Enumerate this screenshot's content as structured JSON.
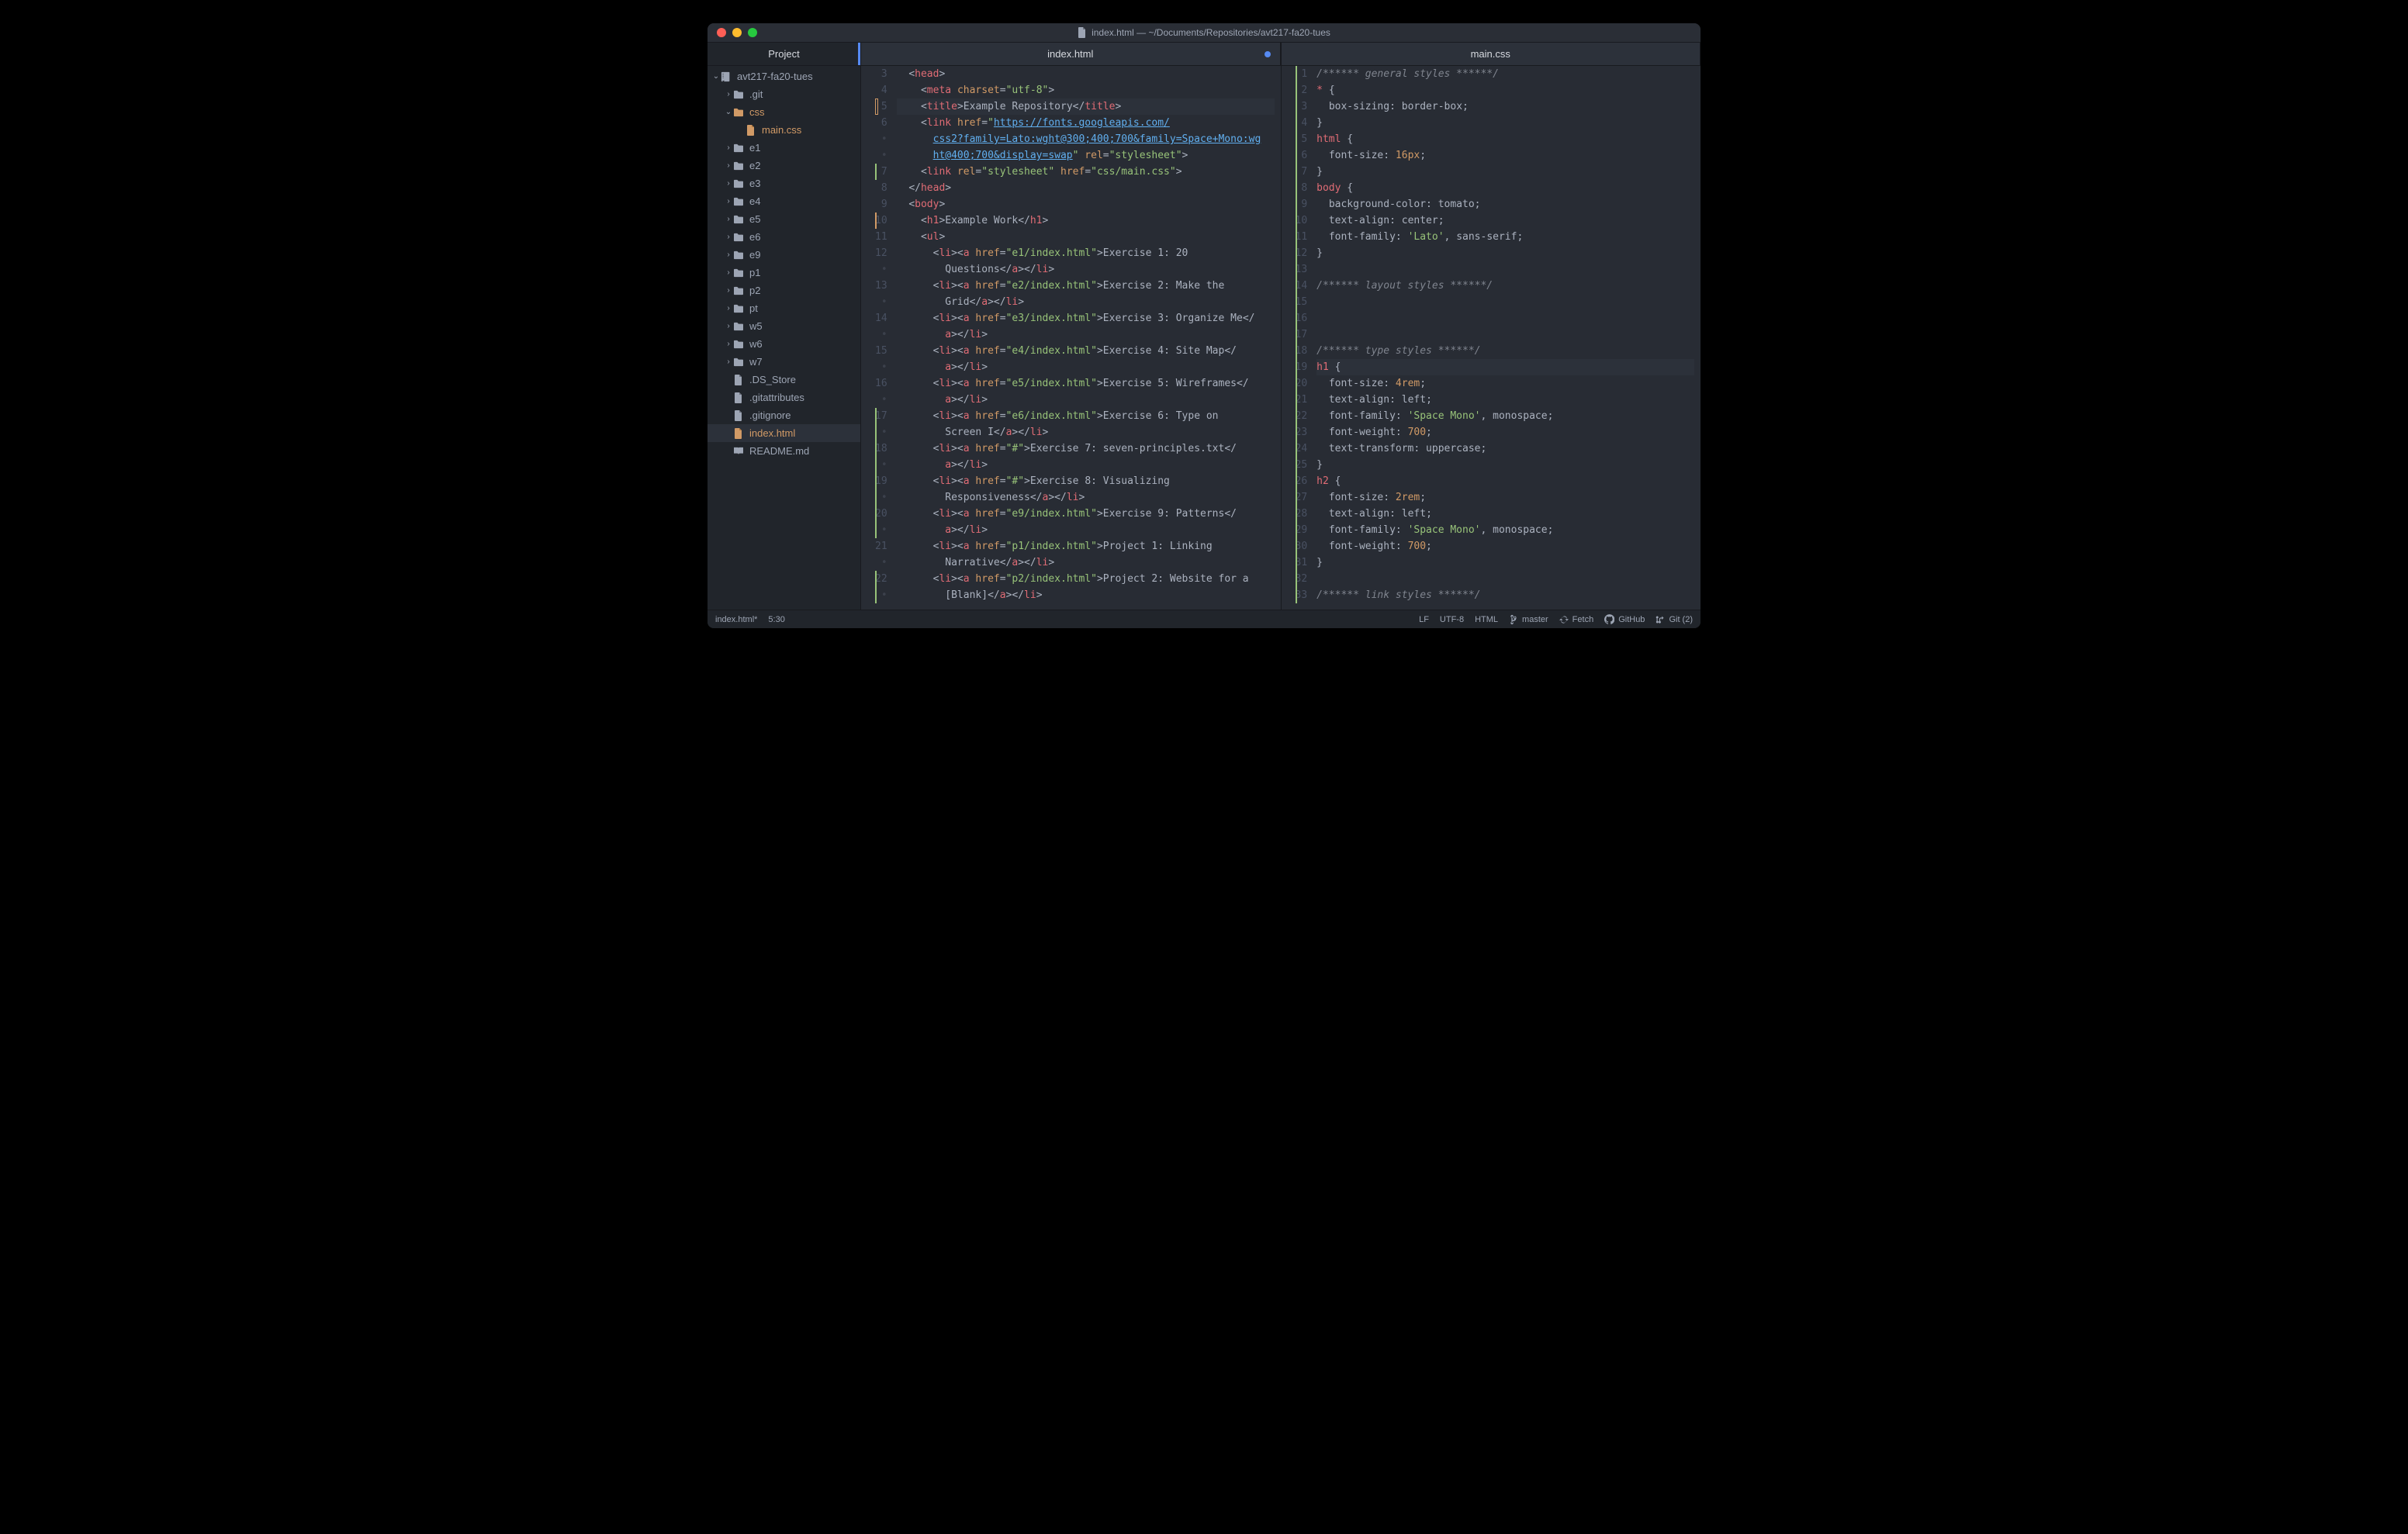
{
  "window": {
    "title": "index.html — ~/Documents/Repositories/avt217-fa20-tues"
  },
  "sidebar": {
    "header": "Project",
    "tree": [
      {
        "depth": 0,
        "kind": "repo",
        "expand": "open",
        "label": "avt217-fa20-tues",
        "mod": false
      },
      {
        "depth": 1,
        "kind": "folder",
        "expand": "closed",
        "label": ".git",
        "mod": false
      },
      {
        "depth": 1,
        "kind": "folder",
        "expand": "open",
        "label": "css",
        "mod": true
      },
      {
        "depth": 2,
        "kind": "file",
        "expand": "none",
        "label": "main.css",
        "mod": true
      },
      {
        "depth": 1,
        "kind": "folder",
        "expand": "closed",
        "label": "e1",
        "mod": false
      },
      {
        "depth": 1,
        "kind": "folder",
        "expand": "closed",
        "label": "e2",
        "mod": false
      },
      {
        "depth": 1,
        "kind": "folder",
        "expand": "closed",
        "label": "e3",
        "mod": false
      },
      {
        "depth": 1,
        "kind": "folder",
        "expand": "closed",
        "label": "e4",
        "mod": false
      },
      {
        "depth": 1,
        "kind": "folder",
        "expand": "closed",
        "label": "e5",
        "mod": false
      },
      {
        "depth": 1,
        "kind": "folder",
        "expand": "closed",
        "label": "e6",
        "mod": false
      },
      {
        "depth": 1,
        "kind": "folder",
        "expand": "closed",
        "label": "e9",
        "mod": false
      },
      {
        "depth": 1,
        "kind": "folder",
        "expand": "closed",
        "label": "p1",
        "mod": false
      },
      {
        "depth": 1,
        "kind": "folder",
        "expand": "closed",
        "label": "p2",
        "mod": false
      },
      {
        "depth": 1,
        "kind": "folder",
        "expand": "closed",
        "label": "pt",
        "mod": false
      },
      {
        "depth": 1,
        "kind": "folder",
        "expand": "closed",
        "label": "w5",
        "mod": false
      },
      {
        "depth": 1,
        "kind": "folder",
        "expand": "closed",
        "label": "w6",
        "mod": false
      },
      {
        "depth": 1,
        "kind": "folder",
        "expand": "closed",
        "label": "w7",
        "mod": false
      },
      {
        "depth": 1,
        "kind": "file",
        "expand": "none",
        "label": ".DS_Store",
        "mod": false
      },
      {
        "depth": 1,
        "kind": "file",
        "expand": "none",
        "label": ".gitattributes",
        "mod": false
      },
      {
        "depth": 1,
        "kind": "file",
        "expand": "none",
        "label": ".gitignore",
        "mod": false
      },
      {
        "depth": 1,
        "kind": "file",
        "expand": "none",
        "label": "index.html",
        "mod": true,
        "selected": true
      },
      {
        "depth": 1,
        "kind": "book",
        "expand": "none",
        "label": "README.md",
        "mod": false
      }
    ]
  },
  "panes": [
    {
      "tab": {
        "label": "index.html",
        "modified": true
      },
      "gutter_start": 3,
      "lines": [
        {
          "n": "3",
          "m": "",
          "html": "  <span class='c-pun'>&lt;</span><span class='c-tag'>head</span><span class='c-pun'>&gt;</span>"
        },
        {
          "n": "4",
          "m": "",
          "html": "    <span class='c-pun'>&lt;</span><span class='c-tag'>meta</span> <span class='c-attr'>charset</span><span class='c-pun'>=</span><span class='c-str'>\"utf-8\"</span><span class='c-pun'>&gt;</span>"
        },
        {
          "n": "5",
          "m": "box",
          "hl": true,
          "html": "    <span class='c-pun'>&lt;</span><span class='c-tag'>title</span><span class='c-pun'>&gt;</span><span class='c-txt'>Example Repository</span><span class='c-pun'>&lt;/</span><span class='c-tag'>title</span><span class='c-pun'>&gt;</span>"
        },
        {
          "n": "6",
          "m": "",
          "html": "    <span class='c-pun'>&lt;</span><span class='c-tag'>link</span> <span class='c-attr'>href</span><span class='c-pun'>=</span><span class='c-str'>\"</span><span class='c-url'>https://fonts.googleapis.com/</span>"
        },
        {
          "n": "•",
          "m": "",
          "html": "      <span class='c-url'>css2?family=Lato:wght@300;400;700&amp;family=Space+Mono:wg</span>"
        },
        {
          "n": "•",
          "m": "",
          "html": "      <span class='c-url'>ht@400;700&amp;display=swap</span><span class='c-str'>\"</span> <span class='c-attr'>rel</span><span class='c-pun'>=</span><span class='c-str'>\"stylesheet\"</span><span class='c-pun'>&gt;</span>"
        },
        {
          "n": "7",
          "m": "green",
          "html": "    <span class='c-pun'>&lt;</span><span class='c-tag'>link</span> <span class='c-attr'>rel</span><span class='c-pun'>=</span><span class='c-str'>\"stylesheet\"</span> <span class='c-attr'>href</span><span class='c-pun'>=</span><span class='c-str'>\"css/main.css\"</span><span class='c-pun'>&gt;</span>"
        },
        {
          "n": "8",
          "m": "",
          "html": "  <span class='c-pun'>&lt;/</span><span class='c-tag'>head</span><span class='c-pun'>&gt;</span>"
        },
        {
          "n": "9",
          "m": "",
          "html": "  <span class='c-pun'>&lt;</span><span class='c-tag'>body</span><span class='c-pun'>&gt;</span>"
        },
        {
          "n": "10",
          "m": "yellow",
          "html": "    <span class='c-pun'>&lt;</span><span class='c-tag'>h1</span><span class='c-pun'>&gt;</span><span class='c-txt'>Example Work</span><span class='c-pun'>&lt;/</span><span class='c-tag'>h1</span><span class='c-pun'>&gt;</span>"
        },
        {
          "n": "11",
          "m": "",
          "html": "    <span class='c-pun'>&lt;</span><span class='c-tag'>ul</span><span class='c-pun'>&gt;</span>"
        },
        {
          "n": "12",
          "m": "",
          "html": "      <span class='c-pun'>&lt;</span><span class='c-tag'>li</span><span class='c-pun'>&gt;&lt;</span><span class='c-tag'>a</span> <span class='c-attr'>href</span><span class='c-pun'>=</span><span class='c-str'>\"e1/index.html\"</span><span class='c-pun'>&gt;</span><span class='c-txt'>Exercise 1: 20 </span>"
        },
        {
          "n": "•",
          "m": "",
          "html": "        <span class='c-txt'>Questions</span><span class='c-pun'>&lt;/</span><span class='c-tag'>a</span><span class='c-pun'>&gt;&lt;/</span><span class='c-tag'>li</span><span class='c-pun'>&gt;</span>"
        },
        {
          "n": "13",
          "m": "",
          "html": "      <span class='c-pun'>&lt;</span><span class='c-tag'>li</span><span class='c-pun'>&gt;&lt;</span><span class='c-tag'>a</span> <span class='c-attr'>href</span><span class='c-pun'>=</span><span class='c-str'>\"e2/index.html\"</span><span class='c-pun'>&gt;</span><span class='c-txt'>Exercise 2: Make the </span>"
        },
        {
          "n": "•",
          "m": "",
          "html": "        <span class='c-txt'>Grid</span><span class='c-pun'>&lt;/</span><span class='c-tag'>a</span><span class='c-pun'>&gt;&lt;/</span><span class='c-tag'>li</span><span class='c-pun'>&gt;</span>"
        },
        {
          "n": "14",
          "m": "",
          "html": "      <span class='c-pun'>&lt;</span><span class='c-tag'>li</span><span class='c-pun'>&gt;&lt;</span><span class='c-tag'>a</span> <span class='c-attr'>href</span><span class='c-pun'>=</span><span class='c-str'>\"e3/index.html\"</span><span class='c-pun'>&gt;</span><span class='c-txt'>Exercise 3: Organize Me</span><span class='c-pun'>&lt;/</span>"
        },
        {
          "n": "•",
          "m": "",
          "html": "        <span class='c-tag'>a</span><span class='c-pun'>&gt;&lt;/</span><span class='c-tag'>li</span><span class='c-pun'>&gt;</span>"
        },
        {
          "n": "15",
          "m": "",
          "html": "      <span class='c-pun'>&lt;</span><span class='c-tag'>li</span><span class='c-pun'>&gt;&lt;</span><span class='c-tag'>a</span> <span class='c-attr'>href</span><span class='c-pun'>=</span><span class='c-str'>\"e4/index.html\"</span><span class='c-pun'>&gt;</span><span class='c-txt'>Exercise 4: Site Map</span><span class='c-pun'>&lt;/</span>"
        },
        {
          "n": "•",
          "m": "",
          "html": "        <span class='c-tag'>a</span><span class='c-pun'>&gt;&lt;/</span><span class='c-tag'>li</span><span class='c-pun'>&gt;</span>"
        },
        {
          "n": "16",
          "m": "",
          "html": "      <span class='c-pun'>&lt;</span><span class='c-tag'>li</span><span class='c-pun'>&gt;&lt;</span><span class='c-tag'>a</span> <span class='c-attr'>href</span><span class='c-pun'>=</span><span class='c-str'>\"e5/index.html\"</span><span class='c-pun'>&gt;</span><span class='c-txt'>Exercise 5: Wireframes</span><span class='c-pun'>&lt;/</span>"
        },
        {
          "n": "•",
          "m": "",
          "html": "        <span class='c-tag'>a</span><span class='c-pun'>&gt;&lt;/</span><span class='c-tag'>li</span><span class='c-pun'>&gt;</span>"
        },
        {
          "n": "17",
          "m": "green",
          "html": "      <span class='c-pun'>&lt;</span><span class='c-tag'>li</span><span class='c-pun'>&gt;&lt;</span><span class='c-tag'>a</span> <span class='c-attr'>href</span><span class='c-pun'>=</span><span class='c-str'>\"e6/index.html\"</span><span class='c-pun'>&gt;</span><span class='c-txt'>Exercise 6: Type on </span>"
        },
        {
          "n": "•",
          "m": "green",
          "html": "        <span class='c-txt'>Screen I</span><span class='c-pun'>&lt;/</span><span class='c-tag'>a</span><span class='c-pun'>&gt;&lt;/</span><span class='c-tag'>li</span><span class='c-pun'>&gt;</span>"
        },
        {
          "n": "18",
          "m": "green",
          "html": "      <span class='c-pun'>&lt;</span><span class='c-tag'>li</span><span class='c-pun'>&gt;&lt;</span><span class='c-tag'>a</span> <span class='c-attr'>href</span><span class='c-pun'>=</span><span class='c-str'>\"#\"</span><span class='c-pun'>&gt;</span><span class='c-txt'>Exercise 7: seven-principles.txt</span><span class='c-pun'>&lt;/</span>"
        },
        {
          "n": "•",
          "m": "green",
          "html": "        <span class='c-tag'>a</span><span class='c-pun'>&gt;&lt;/</span><span class='c-tag'>li</span><span class='c-pun'>&gt;</span>"
        },
        {
          "n": "19",
          "m": "green",
          "html": "      <span class='c-pun'>&lt;</span><span class='c-tag'>li</span><span class='c-pun'>&gt;&lt;</span><span class='c-tag'>a</span> <span class='c-attr'>href</span><span class='c-pun'>=</span><span class='c-str'>\"#\"</span><span class='c-pun'>&gt;</span><span class='c-txt'>Exercise 8: Visualizing </span>"
        },
        {
          "n": "•",
          "m": "green",
          "html": "        <span class='c-txt'>Responsiveness</span><span class='c-pun'>&lt;/</span><span class='c-tag'>a</span><span class='c-pun'>&gt;&lt;/</span><span class='c-tag'>li</span><span class='c-pun'>&gt;</span>"
        },
        {
          "n": "20",
          "m": "green",
          "html": "      <span class='c-pun'>&lt;</span><span class='c-tag'>li</span><span class='c-pun'>&gt;&lt;</span><span class='c-tag'>a</span> <span class='c-attr'>href</span><span class='c-pun'>=</span><span class='c-str'>\"e9/index.html\"</span><span class='c-pun'>&gt;</span><span class='c-txt'>Exercise 9: Patterns</span><span class='c-pun'>&lt;/</span>"
        },
        {
          "n": "•",
          "m": "green",
          "html": "        <span class='c-tag'>a</span><span class='c-pun'>&gt;&lt;/</span><span class='c-tag'>li</span><span class='c-pun'>&gt;</span>"
        },
        {
          "n": "21",
          "m": "",
          "html": "      <span class='c-pun'>&lt;</span><span class='c-tag'>li</span><span class='c-pun'>&gt;&lt;</span><span class='c-tag'>a</span> <span class='c-attr'>href</span><span class='c-pun'>=</span><span class='c-str'>\"p1/index.html\"</span><span class='c-pun'>&gt;</span><span class='c-txt'>Project 1: Linking </span>"
        },
        {
          "n": "•",
          "m": "",
          "html": "        <span class='c-txt'>Narrative</span><span class='c-pun'>&lt;/</span><span class='c-tag'>a</span><span class='c-pun'>&gt;&lt;/</span><span class='c-tag'>li</span><span class='c-pun'>&gt;</span>"
        },
        {
          "n": "22",
          "m": "green",
          "html": "      <span class='c-pun'>&lt;</span><span class='c-tag'>li</span><span class='c-pun'>&gt;&lt;</span><span class='c-tag'>a</span> <span class='c-attr'>href</span><span class='c-pun'>=</span><span class='c-str'>\"p2/index.html\"</span><span class='c-pun'>&gt;</span><span class='c-txt'>Project 2: Website for a </span>"
        },
        {
          "n": "•",
          "m": "green",
          "html": "        <span class='c-txt'>[Blank]</span><span class='c-pun'>&lt;/</span><span class='c-tag'>a</span><span class='c-pun'>&gt;&lt;/</span><span class='c-tag'>li</span><span class='c-pun'>&gt;</span>"
        }
      ]
    },
    {
      "tab": {
        "label": "main.css",
        "modified": false
      },
      "lines": [
        {
          "n": "1",
          "m": "green",
          "html": "<span class='c-com'>/****** general styles ******/</span>"
        },
        {
          "n": "2",
          "m": "green",
          "html": "<span class='c-sel'>*</span> <span class='c-pun'>{</span>"
        },
        {
          "n": "3",
          "m": "green",
          "html": "  <span class='c-prop'>box-sizing</span><span class='c-pun'>:</span> <span class='c-txt'>border-box</span><span class='c-pun'>;</span>"
        },
        {
          "n": "4",
          "m": "green",
          "html": "<span class='c-pun'>}</span>"
        },
        {
          "n": "5",
          "m": "green",
          "html": "<span class='c-sel'>html</span> <span class='c-pun'>{</span>"
        },
        {
          "n": "6",
          "m": "green",
          "html": "  <span class='c-prop'>font-size</span><span class='c-pun'>:</span> <span class='c-num'>16px</span><span class='c-pun'>;</span>"
        },
        {
          "n": "7",
          "m": "green",
          "html": "<span class='c-pun'>}</span>"
        },
        {
          "n": "8",
          "m": "green",
          "html": "<span class='c-sel'>body</span> <span class='c-pun'>{</span>"
        },
        {
          "n": "9",
          "m": "green",
          "html": "  <span class='c-prop'>background-color</span><span class='c-pun'>:</span> <span class='c-txt'>tomato</span><span class='c-pun'>;</span>"
        },
        {
          "n": "10",
          "m": "green",
          "html": "  <span class='c-prop'>text-align</span><span class='c-pun'>:</span> <span class='c-txt'>center</span><span class='c-pun'>;</span>"
        },
        {
          "n": "11",
          "m": "green",
          "html": "  <span class='c-prop'>font-family</span><span class='c-pun'>:</span> <span class='c-str'>'Lato'</span><span class='c-pun'>,</span> <span class='c-txt'>sans-serif</span><span class='c-pun'>;</span>"
        },
        {
          "n": "12",
          "m": "green",
          "html": "<span class='c-pun'>}</span>"
        },
        {
          "n": "13",
          "m": "green",
          "html": ""
        },
        {
          "n": "14",
          "m": "green",
          "html": "<span class='c-com'>/****** layout styles ******/</span>"
        },
        {
          "n": "15",
          "m": "green",
          "html": ""
        },
        {
          "n": "16",
          "m": "green",
          "html": ""
        },
        {
          "n": "17",
          "m": "green",
          "html": ""
        },
        {
          "n": "18",
          "m": "green",
          "html": "<span class='c-com'>/****** type styles ******/</span>"
        },
        {
          "n": "19",
          "m": "green",
          "hl": true,
          "html": "<span class='c-sel'>h1</span> <span class='c-pun'>{</span>"
        },
        {
          "n": "20",
          "m": "green",
          "html": "  <span class='c-prop'>font-size</span><span class='c-pun'>:</span> <span class='c-num'>4rem</span><span class='c-pun'>;</span>"
        },
        {
          "n": "21",
          "m": "green",
          "html": "  <span class='c-prop'>text-align</span><span class='c-pun'>:</span> <span class='c-txt'>left</span><span class='c-pun'>;</span>"
        },
        {
          "n": "22",
          "m": "green",
          "html": "  <span class='c-prop'>font-family</span><span class='c-pun'>:</span> <span class='c-str'>'Space Mono'</span><span class='c-pun'>,</span> <span class='c-txt'>monospace</span><span class='c-pun'>;</span>"
        },
        {
          "n": "23",
          "m": "green",
          "html": "  <span class='c-prop'>font-weight</span><span class='c-pun'>:</span> <span class='c-num'>700</span><span class='c-pun'>;</span>"
        },
        {
          "n": "24",
          "m": "green",
          "html": "  <span class='c-prop'>text-transform</span><span class='c-pun'>:</span> <span class='c-txt'>uppercase</span><span class='c-pun'>;</span>"
        },
        {
          "n": "25",
          "m": "green",
          "html": "<span class='c-pun'>}</span>"
        },
        {
          "n": "26",
          "m": "green",
          "html": "<span class='c-sel'>h2</span> <span class='c-pun'>{</span>"
        },
        {
          "n": "27",
          "m": "green",
          "html": "  <span class='c-prop'>font-size</span><span class='c-pun'>:</span> <span class='c-num'>2rem</span><span class='c-pun'>;</span>"
        },
        {
          "n": "28",
          "m": "green",
          "html": "  <span class='c-prop'>text-align</span><span class='c-pun'>:</span> <span class='c-txt'>left</span><span class='c-pun'>;</span>"
        },
        {
          "n": "29",
          "m": "green",
          "html": "  <span class='c-prop'>font-family</span><span class='c-pun'>:</span> <span class='c-str'>'Space Mono'</span><span class='c-pun'>,</span> <span class='c-txt'>monospace</span><span class='c-pun'>;</span>"
        },
        {
          "n": "30",
          "m": "green",
          "html": "  <span class='c-prop'>font-weight</span><span class='c-pun'>:</span> <span class='c-num'>700</span><span class='c-pun'>;</span>"
        },
        {
          "n": "31",
          "m": "green",
          "html": "<span class='c-pun'>}</span>"
        },
        {
          "n": "32",
          "m": "green",
          "html": ""
        },
        {
          "n": "33",
          "m": "green",
          "html": "<span class='c-com'>/****** link styles ******/</span>"
        }
      ]
    }
  ],
  "status": {
    "file": "index.html*",
    "cursor": "5:30",
    "eol": "LF",
    "encoding": "UTF-8",
    "grammar": "HTML",
    "branch": "master",
    "fetch": "Fetch",
    "github": "GitHub",
    "git": "Git (2)"
  }
}
